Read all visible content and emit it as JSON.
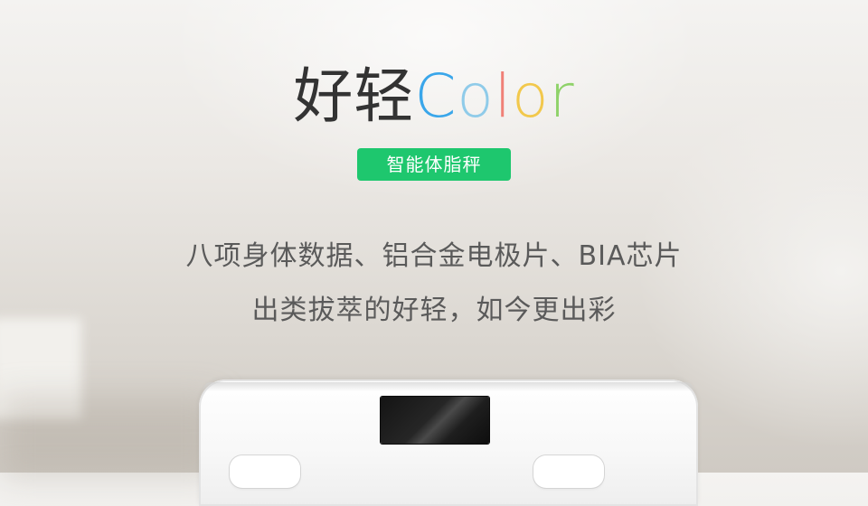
{
  "headline": {
    "chinese": "好轻",
    "latin": [
      "C",
      "o",
      "l",
      "o",
      "r"
    ]
  },
  "badge": {
    "label": "智能体脂秤"
  },
  "description": {
    "line1": "八项身体数据、铝合金电极片、BIA芯片",
    "line2": "出类拔萃的好轻，如今更出彩"
  },
  "colors": {
    "badge_green": "#1ec76e",
    "letter_C": "#3aa6ea",
    "letter_o1": "#8fcbe9",
    "letter_l": "#f08077",
    "letter_o2": "#f2c84c",
    "letter_r": "#8fd269",
    "text_gray": "#5a5a5a"
  }
}
